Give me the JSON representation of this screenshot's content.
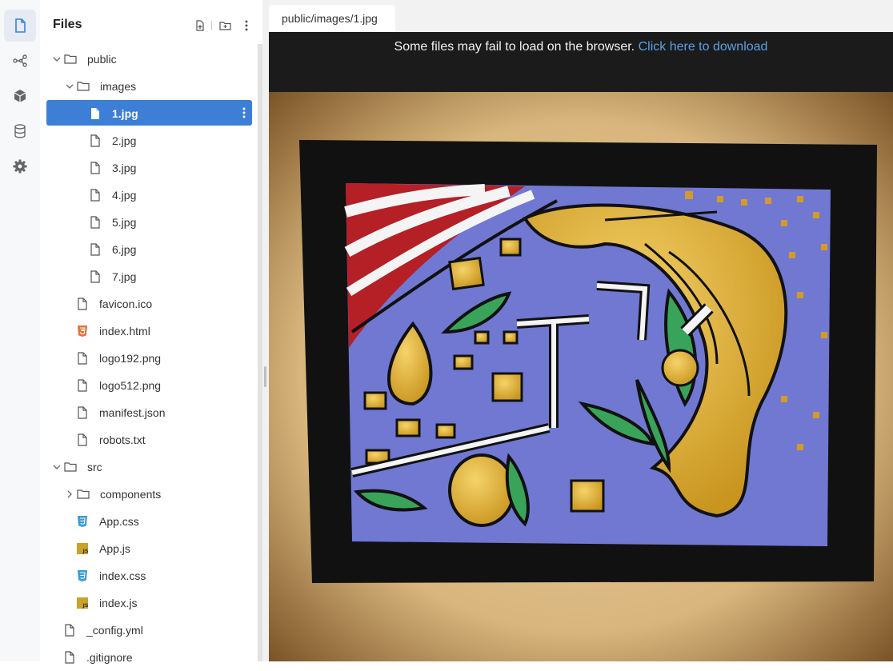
{
  "activity_bar": {
    "items": [
      {
        "name": "files",
        "active": true
      },
      {
        "name": "git-graph",
        "active": false
      },
      {
        "name": "packages",
        "active": false
      },
      {
        "name": "database",
        "active": false
      },
      {
        "name": "settings",
        "active": false
      }
    ]
  },
  "sidebar": {
    "title": "Files",
    "new_file_icon": "new-file-icon",
    "new_folder_icon": "new-folder-icon",
    "more_icon": "more-vertical-icon"
  },
  "tree": [
    {
      "label": "public",
      "type": "folder",
      "expanded": true
    },
    {
      "label": "images",
      "type": "folder",
      "expanded": true
    },
    {
      "label": "1.jpg",
      "type": "file",
      "selected": true
    },
    {
      "label": "2.jpg",
      "type": "file"
    },
    {
      "label": "3.jpg",
      "type": "file"
    },
    {
      "label": "4.jpg",
      "type": "file"
    },
    {
      "label": "5.jpg",
      "type": "file"
    },
    {
      "label": "6.jpg",
      "type": "file"
    },
    {
      "label": "7.jpg",
      "type": "file"
    },
    {
      "label": "favicon.ico",
      "type": "file"
    },
    {
      "label": "index.html",
      "type": "html"
    },
    {
      "label": "logo192.png",
      "type": "file"
    },
    {
      "label": "logo512.png",
      "type": "file"
    },
    {
      "label": "manifest.json",
      "type": "file"
    },
    {
      "label": "robots.txt",
      "type": "file"
    },
    {
      "label": "src",
      "type": "folder",
      "expanded": true
    },
    {
      "label": "components",
      "type": "folder",
      "expanded": false
    },
    {
      "label": "App.css",
      "type": "css"
    },
    {
      "label": "App.js",
      "type": "js"
    },
    {
      "label": "index.css",
      "type": "css"
    },
    {
      "label": "index.js",
      "type": "js"
    },
    {
      "label": "_config.yml",
      "type": "file"
    },
    {
      "label": ".gitignore",
      "type": "file"
    }
  ],
  "editor": {
    "tab_label": "public/images/1.jpg",
    "notice_text": "Some files may fail to load on the browser.",
    "notice_link": "Click here to download"
  },
  "colors": {
    "accent": "#3d7fd6",
    "link": "#5aa0e6",
    "html_icon": "#e8703a",
    "css_icon": "#3a9ad9",
    "js_icon": "#c9a227"
  }
}
